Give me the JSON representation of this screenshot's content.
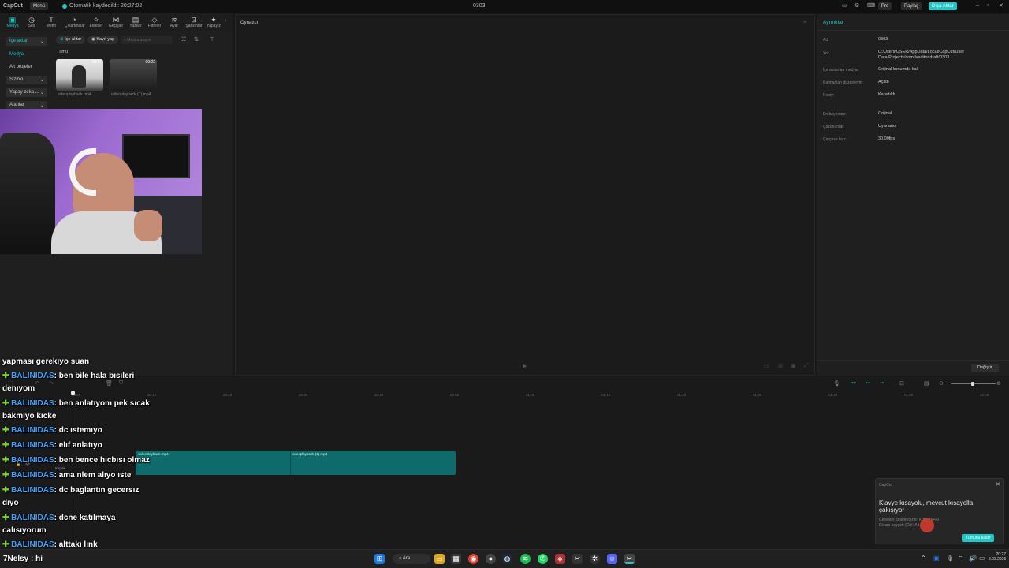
{
  "titlebar": {
    "logo": "CapCut",
    "menu": "Menü",
    "autosave": "Otomatik kaydedildi: 20:27:02",
    "project": "0303",
    "pro": "Pro",
    "share": "Paylaş",
    "export": "Dışa Aktar"
  },
  "toolbar": {
    "items": [
      {
        "label": "Medya",
        "icon": "media-icon",
        "glyph": "▣"
      },
      {
        "label": "Ses",
        "icon": "audio-icon",
        "glyph": "◷"
      },
      {
        "label": "Metin",
        "icon": "text-icon",
        "glyph": "T"
      },
      {
        "label": "Çıkartmalar",
        "icon": "sticker-icon",
        "glyph": "◔"
      },
      {
        "label": "Efektler",
        "icon": "effects-icon",
        "glyph": "✧"
      },
      {
        "label": "Geçişler",
        "icon": "transition-icon",
        "glyph": "⋈"
      },
      {
        "label": "Yazılar",
        "icon": "captions-icon",
        "glyph": "▤"
      },
      {
        "label": "Filtreler",
        "icon": "filter-icon",
        "glyph": "◇"
      },
      {
        "label": "Ayar",
        "icon": "adjust-icon",
        "glyph": "≋"
      },
      {
        "label": "Şablonlar",
        "icon": "template-icon",
        "glyph": "⊡"
      },
      {
        "label": "Yapay z",
        "icon": "ai-icon",
        "glyph": "✦"
      }
    ]
  },
  "leftpanel": {
    "import_btn": "İçe aktar",
    "import_tab": "İçe aktar",
    "record": "Kayıt yap",
    "search_placeholder": "Medya arayın",
    "nav": [
      "Medya",
      "Alt projeler",
      "Sizinki",
      "Yapay zeka ...",
      "Alanlar"
    ],
    "all": "Tümü",
    "media": [
      {
        "name": "videoplayback.mp4",
        "duration": "00:37"
      },
      {
        "name": "videoplayback (1).mp4",
        "duration": "00:22"
      }
    ]
  },
  "player": {
    "title": "Oynatıcı"
  },
  "rightpanel": {
    "title": "Ayrıntılar",
    "rows": [
      {
        "label": "Ad:",
        "value": "0303"
      },
      {
        "label": "Yol:",
        "value": "C:/Users/USER/AppData/Local/CapCut/User Data/Projects/com.lveditor.draft/0303"
      },
      {
        "label": "İçe aktarılan medya:",
        "value": "Orijinal konumda kal"
      },
      {
        "label": "Katmanları düzenleyin:",
        "value": "Açıldı"
      },
      {
        "label": "Proxy:",
        "value": "Kapatıldı"
      },
      {
        "label": "En boy oranı:",
        "value": "Orijinal"
      },
      {
        "label": "Çözünürlük:",
        "value": "Uyarlandı"
      },
      {
        "label": "Çerçeve hızı:",
        "value": "30.00fps"
      }
    ],
    "change_btn": "Değiştir"
  },
  "timeline": {
    "ticks": [
      "00:00",
      "00:10",
      "00:20",
      "00:30",
      "00:40",
      "00:50",
      "01:00",
      "01:10",
      "01:20",
      "01:30",
      "01:40",
      "01:50",
      "02:00"
    ],
    "clips": [
      {
        "name": "videoplayback.mp4"
      },
      {
        "name": "videoplayback (1).mp4"
      }
    ],
    "cover": "Kapak"
  },
  "chat": [
    {
      "user": "",
      "text": "yapması gerekıyo suan"
    },
    {
      "user": "BALINIDAS",
      "text": ": ben bile hala bısıleri"
    },
    {
      "user": "",
      "text": "denıyom"
    },
    {
      "user": "BALINIDAS",
      "text": ": ben anlatıyom pek sıcak"
    },
    {
      "user": "",
      "text": "bakmıyo kıcke"
    },
    {
      "user": "BALINIDAS",
      "text": ": dc ıstemıyo"
    },
    {
      "user": "BALINIDAS",
      "text": ": elıf anlatıyo"
    },
    {
      "user": "BALINIDAS",
      "text": ": ben bence hıcbısı olmaz"
    },
    {
      "user": "BALINIDAS",
      "text": ": ama nlem alıyo ıste"
    },
    {
      "user": "BALINIDAS",
      "text": ": dc baglantın gecersız"
    },
    {
      "user": "",
      "text": "dıyo"
    },
    {
      "user": "BALINIDAS",
      "text": ": dcne katılmaya"
    },
    {
      "user": "",
      "text": "calısıyorum"
    },
    {
      "user": "BALINIDAS",
      "text": ": alttakı lınk"
    },
    {
      "user": "",
      "text": "7Nelsy : hi"
    }
  ],
  "notification": {
    "app": "CapCut",
    "title": "Klavye kısayolu, mevcut kısayolla çakışıyor",
    "line1": "Cetvelleri göster/gizle: [Ctrl+Alt+R]",
    "line2": "Ekranı kaydet: [Ctrl+Alt+R]",
    "btn": "Tümünü kaldır"
  },
  "taskbar": {
    "search": "Ara",
    "time": "20:27",
    "date": "3.03.2026"
  },
  "colors": {
    "accent": "#1ec8c8",
    "clip": "#0f6b6b",
    "chat_user": "#3fa3ff"
  }
}
